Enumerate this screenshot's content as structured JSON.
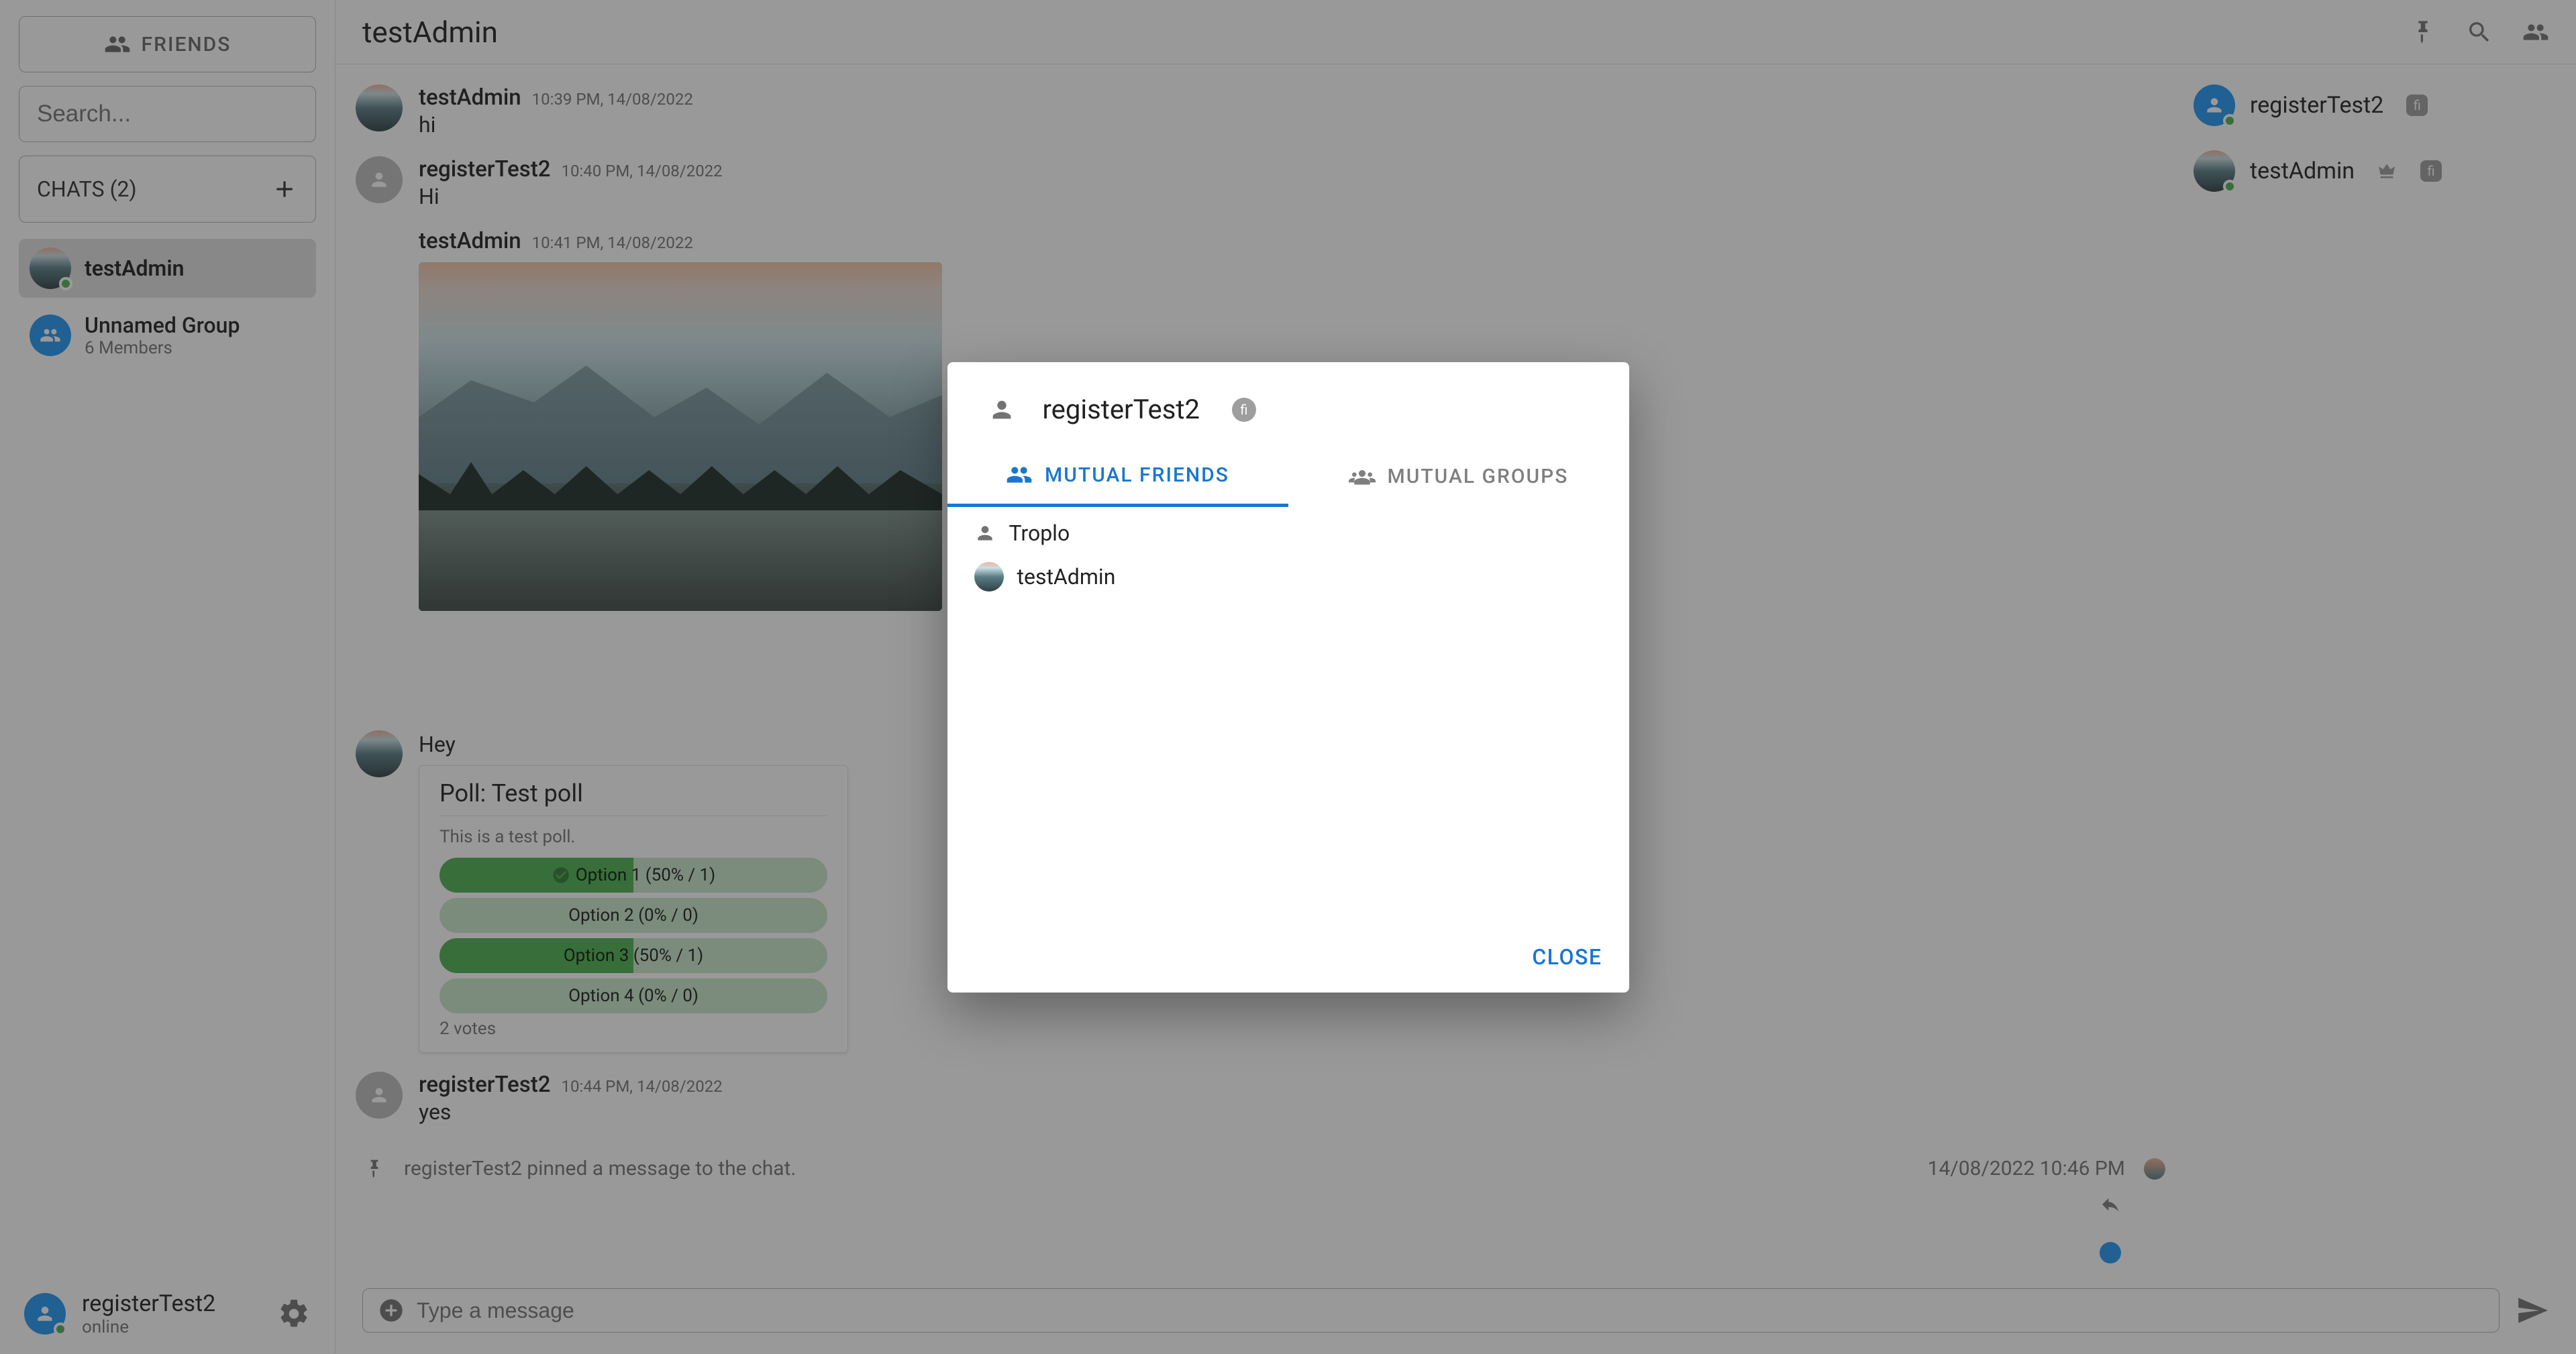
{
  "sidebar": {
    "friends_label": "FRIENDS",
    "search_placeholder": "Search...",
    "chats_header_label": "CHATS (2)",
    "chats": [
      {
        "name": "testAdmin",
        "subtitle": ""
      },
      {
        "name": "Unnamed Group",
        "subtitle": "6 Members"
      }
    ],
    "footer_user": "registerTest2",
    "footer_status": "online"
  },
  "chat_header": {
    "title": "testAdmin"
  },
  "messages": {
    "m1": {
      "author": "testAdmin",
      "ts": "10:39 PM, 14/08/2022",
      "body": "hi"
    },
    "m2": {
      "author": "registerTest2",
      "ts": "10:40 PM, 14/08/2022",
      "body": "Hi"
    },
    "m3": {
      "author": "testAdmin",
      "ts": "10:41 PM, 14/08/2022",
      "body": "Hey"
    },
    "m4": {
      "author": "registerTest2",
      "ts": "10:44 PM, 14/08/2022",
      "body": "yes"
    },
    "pinned": {
      "text": "registerTest2 pinned a message to the chat.",
      "ts": "14/08/2022 10:46 PM"
    }
  },
  "poll": {
    "title": "Poll: Test poll",
    "description": "This is a test poll.",
    "options": [
      {
        "label": "Option 1 (50% / 1)",
        "fill": 50,
        "checked": true
      },
      {
        "label": "Option 2 (0% / 0)",
        "fill": 0,
        "checked": false
      },
      {
        "label": "Option 3 (50% / 1)",
        "fill": 50,
        "checked": false
      },
      {
        "label": "Option 4 (0% / 0)",
        "fill": 0,
        "checked": false
      }
    ],
    "votes_label": "2 votes"
  },
  "right_panel": {
    "members": [
      {
        "name": "registerTest2",
        "badge": "fi",
        "crown": false,
        "blue": true
      },
      {
        "name": "testAdmin",
        "badge": "fi",
        "crown": true,
        "blue": false
      }
    ]
  },
  "composer": {
    "placeholder": "Type a message"
  },
  "dialog": {
    "username": "registerTest2",
    "badge": "fi",
    "tab_friends": "MUTUAL FRIENDS",
    "tab_groups": "MUTUAL GROUPS",
    "friends": [
      {
        "name": "Troplo",
        "avatar": "icon"
      },
      {
        "name": "testAdmin",
        "avatar": "landscape"
      }
    ],
    "close_label": "CLOSE"
  }
}
